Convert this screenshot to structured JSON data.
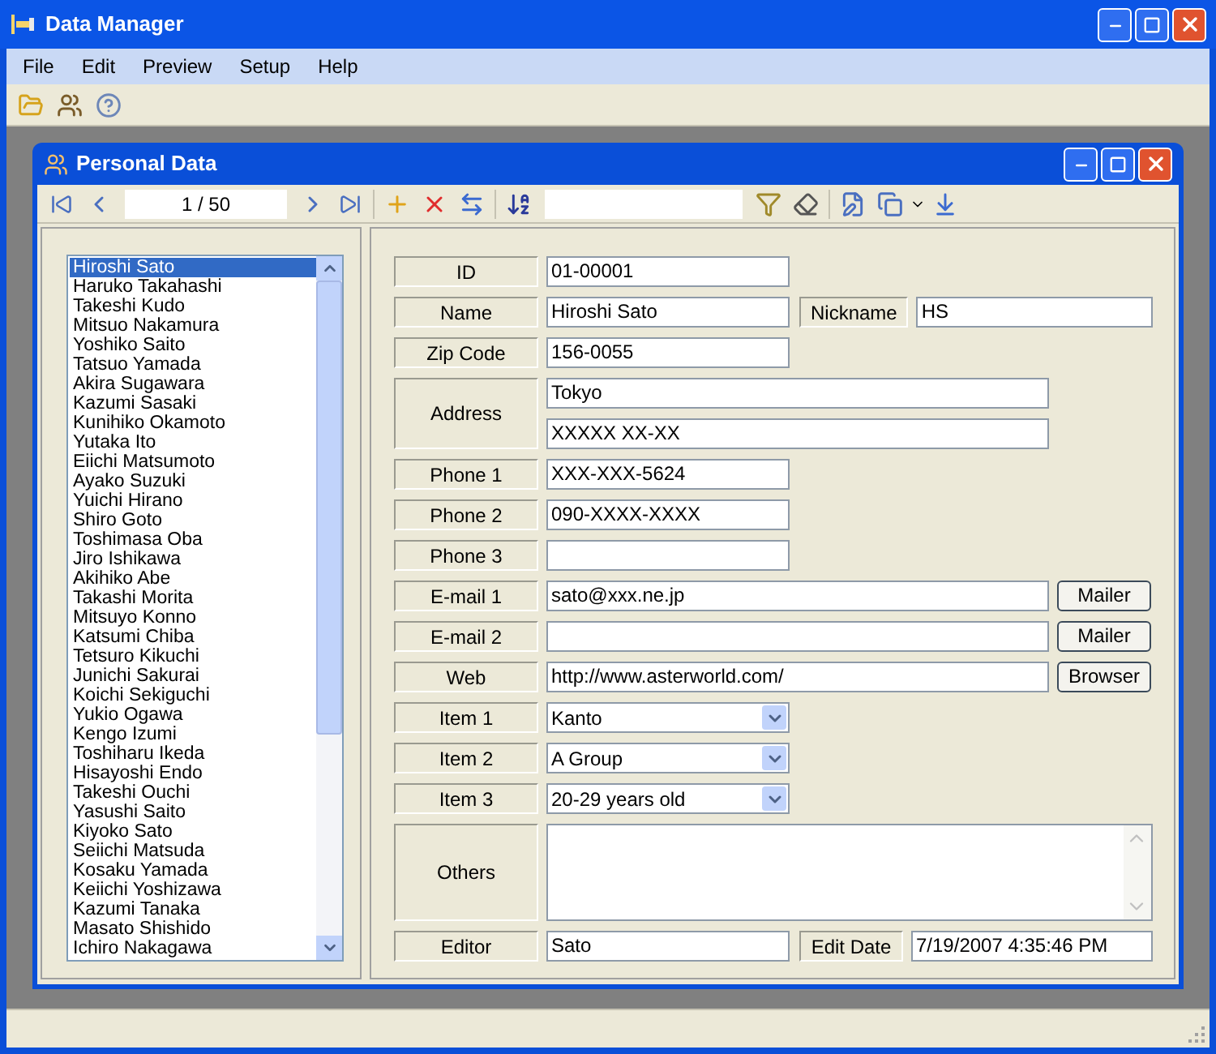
{
  "window": {
    "title": "Data Manager"
  },
  "menu": [
    "File",
    "Edit",
    "Preview",
    "Setup",
    "Help"
  ],
  "child": {
    "title": "Personal Data",
    "record": "1 / 50"
  },
  "people": [
    {
      "name": "Hiroshi Sato",
      "selected": true
    },
    {
      "name": "Haruko Takahashi",
      "selected": false
    },
    {
      "name": "Takeshi Kudo",
      "selected": false
    },
    {
      "name": "Mitsuo Nakamura",
      "selected": false
    },
    {
      "name": "Yoshiko Saito",
      "selected": false
    },
    {
      "name": "Tatsuo Yamada",
      "selected": false
    },
    {
      "name": "Akira Sugawara",
      "selected": false
    },
    {
      "name": "Kazumi Sasaki",
      "selected": false
    },
    {
      "name": "Kunihiko Okamoto",
      "selected": false
    },
    {
      "name": "Yutaka Ito",
      "selected": false
    },
    {
      "name": "Eiichi Matsumoto",
      "selected": false
    },
    {
      "name": "Ayako Suzuki",
      "selected": false
    },
    {
      "name": "Yuichi Hirano",
      "selected": false
    },
    {
      "name": "Shiro Goto",
      "selected": false
    },
    {
      "name": "Toshimasa Oba",
      "selected": false
    },
    {
      "name": "Jiro Ishikawa",
      "selected": false
    },
    {
      "name": "Akihiko Abe",
      "selected": false
    },
    {
      "name": "Takashi Morita",
      "selected": false
    },
    {
      "name": "Mitsuyo Konno",
      "selected": false
    },
    {
      "name": "Katsumi Chiba",
      "selected": false
    },
    {
      "name": "Tetsuro Kikuchi",
      "selected": false
    },
    {
      "name": "Junichi Sakurai",
      "selected": false
    },
    {
      "name": "Koichi Sekiguchi",
      "selected": false
    },
    {
      "name": "Yukio Ogawa",
      "selected": false
    },
    {
      "name": "Kengo Izumi",
      "selected": false
    },
    {
      "name": "Toshiharu Ikeda",
      "selected": false
    },
    {
      "name": "Hisayoshi Endo",
      "selected": false
    },
    {
      "name": "Takeshi Ouchi",
      "selected": false
    },
    {
      "name": "Yasushi Saito",
      "selected": false
    },
    {
      "name": "Kiyoko Sato",
      "selected": false
    },
    {
      "name": "Seiichi Matsuda",
      "selected": false
    },
    {
      "name": "Kosaku Yamada",
      "selected": false
    },
    {
      "name": "Keiichi Yoshizawa",
      "selected": false
    },
    {
      "name": "Kazumi Tanaka",
      "selected": false
    },
    {
      "name": "Masato Shishido",
      "selected": false
    },
    {
      "name": "Ichiro Nakagawa",
      "selected": false
    }
  ],
  "form": [
    {
      "kind": "short",
      "label": "ID",
      "value": "01-00001"
    },
    {
      "kind": "pair",
      "label": "Name",
      "value": "Hiroshi Sato",
      "label2": "Nickname",
      "value2": "HS"
    },
    {
      "kind": "short",
      "label": "Zip Code",
      "value": "156-0055"
    },
    {
      "kind": "multi",
      "label": "Address",
      "values": [
        "Tokyo",
        "XXXXX XX-XX"
      ]
    },
    {
      "kind": "short",
      "label": "Phone 1",
      "value": "XXX-XXX-5624"
    },
    {
      "kind": "short",
      "label": "Phone 2",
      "value": "090-XXXX-XXXX"
    },
    {
      "kind": "short",
      "label": "Phone 3"
    },
    {
      "kind": "action",
      "label": "E-mail 1",
      "value": "sato@xxx.ne.jp",
      "button": "Mailer"
    },
    {
      "kind": "action",
      "label": "E-mail 2",
      "button": "Mailer"
    },
    {
      "kind": "action",
      "label": "Web",
      "value": "http://www.asterworld.com/",
      "button": "Browser"
    },
    {
      "kind": "select",
      "label": "Item 1",
      "value": "Kanto"
    },
    {
      "kind": "select",
      "label": "Item 2",
      "value": "A Group"
    },
    {
      "kind": "select",
      "label": "Item 3",
      "value": "20-29 years old"
    },
    {
      "kind": "memo",
      "label": "Others"
    },
    {
      "kind": "pair",
      "label": "Editor",
      "value": "Sato",
      "label2": "Edit Date",
      "value2": "7/19/2007 4:35:46 PM"
    }
  ]
}
